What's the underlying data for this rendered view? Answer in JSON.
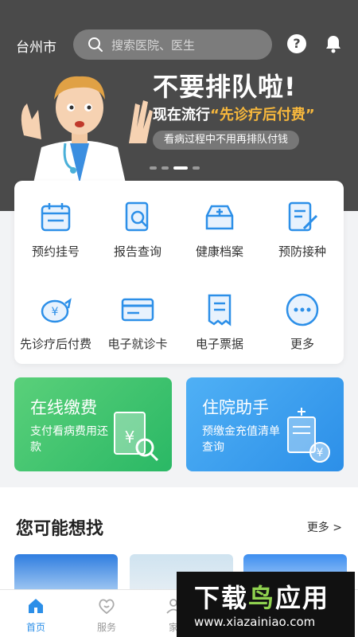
{
  "header": {
    "city": "台州市",
    "search_placeholder": "搜索医院、医生",
    "help_label": "?"
  },
  "banner": {
    "title": "不要排队啦!",
    "line_prefix": "现在流行",
    "line_highlight": "“先诊疗后付费”",
    "pill": "看病过程中不用再排队付钱",
    "slides_total": 4,
    "active_slide": 3,
    "accent": "#f6b73c"
  },
  "grid": [
    {
      "label": "预约挂号",
      "icon": "calendar-icon"
    },
    {
      "label": "报告查询",
      "icon": "report-search-icon"
    },
    {
      "label": "健康档案",
      "icon": "health-archive-icon"
    },
    {
      "label": "预防接种",
      "icon": "vaccine-icon"
    },
    {
      "label": "先诊疗后付费",
      "icon": "piggy-bank-icon"
    },
    {
      "label": "电子就诊卡",
      "icon": "card-icon"
    },
    {
      "label": "电子票据",
      "icon": "receipt-icon"
    },
    {
      "label": "更多",
      "icon": "more-icon"
    }
  ],
  "cards": {
    "pay": {
      "title": "在线缴费",
      "sub": "支付看病费用还款"
    },
    "hospital": {
      "title": "住院助手",
      "sub": "预缴金充值清单查询"
    }
  },
  "section": {
    "title": "您可能想找",
    "more": "更多 >"
  },
  "tabs": [
    {
      "label": "首页",
      "icon": "home-icon"
    },
    {
      "label": "服务",
      "icon": "service-icon"
    },
    {
      "label": "家",
      "icon": "family-icon"
    }
  ],
  "watermark": {
    "brand_a": "下载",
    "brand_b": "鸟",
    "brand_c": "应用",
    "url": "www.xiazainiao.com"
  },
  "colors": {
    "primary": "#2c8fe8",
    "green": "#2ab865",
    "dark": "#4a4a4a"
  }
}
